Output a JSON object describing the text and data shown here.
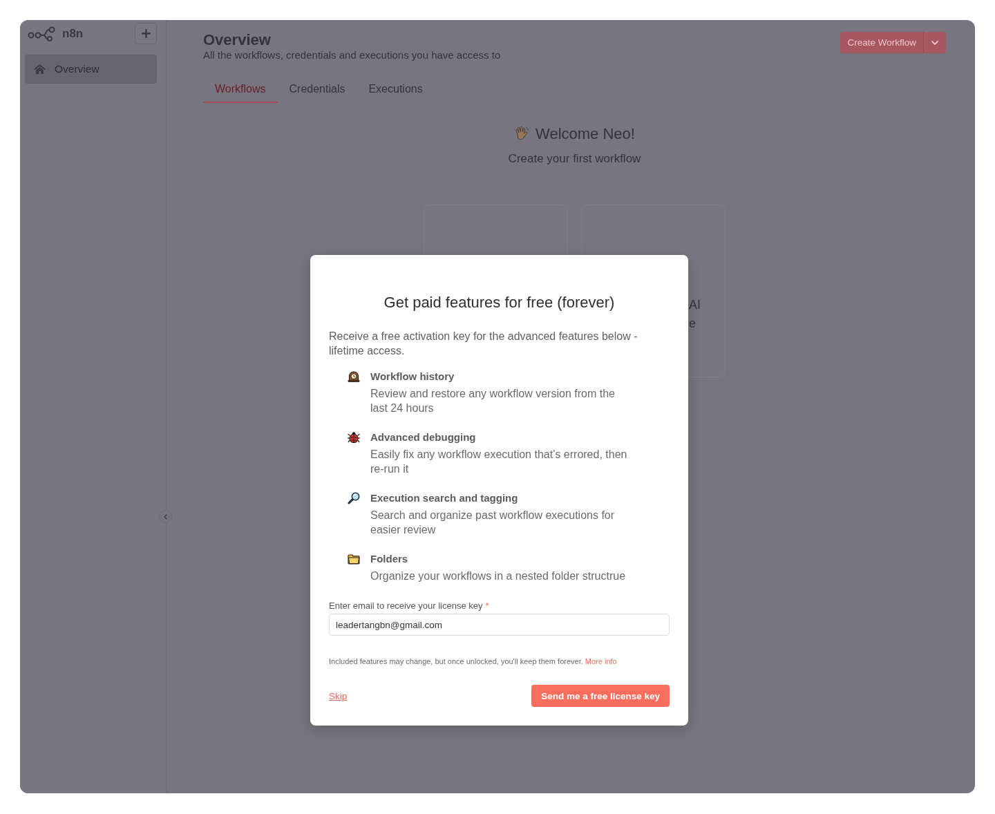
{
  "sidebar": {
    "logo_text": "n8n",
    "items": [
      {
        "label": "Overview",
        "selected": true
      }
    ]
  },
  "header": {
    "title": "Overview",
    "subtitle": "All the workflows, credentials and executions you have access to",
    "primary_action": "Create Workflow"
  },
  "tabs": [
    {
      "label": "Workflows",
      "selected": true
    },
    {
      "label": "Credentials",
      "selected": false
    },
    {
      "label": "Executions",
      "selected": false
    }
  ],
  "welcome": {
    "title": "Welcome Neo!",
    "subtitle": "Create your first workflow"
  },
  "cards": [
    {
      "kind": "empty"
    },
    {
      "kind": "text",
      "lines": [
        "AI",
        "e"
      ]
    }
  ],
  "modal": {
    "title": "Get paid features for free (forever)",
    "intro": "Receive a free activation key for the advanced features below - lifetime access.",
    "features": [
      {
        "kind": "history",
        "title": "Workflow history",
        "description": "Review and restore any workflow version from the last 24 hours"
      },
      {
        "kind": "debugging",
        "title": "Advanced debugging",
        "description": "Easily fix any workflow execution that’s errored, then re-run it"
      },
      {
        "kind": "search",
        "title": "Execution search and tagging",
        "description": "Search and organize past workflow executions for easier review"
      },
      {
        "kind": "folders",
        "title": "Folders",
        "description": "Organize your workflows in a nested folder structrue"
      }
    ],
    "email": {
      "label": "Enter email to receive your license key",
      "required_mark": "*",
      "value": "leadertangbn@gmail.com"
    },
    "note": {
      "text": "Included features may change, but once unlocked, you'll keep them forever.",
      "link": "More info"
    },
    "secondary_action": "Skip",
    "primary_action": "Send me a free license key"
  }
}
